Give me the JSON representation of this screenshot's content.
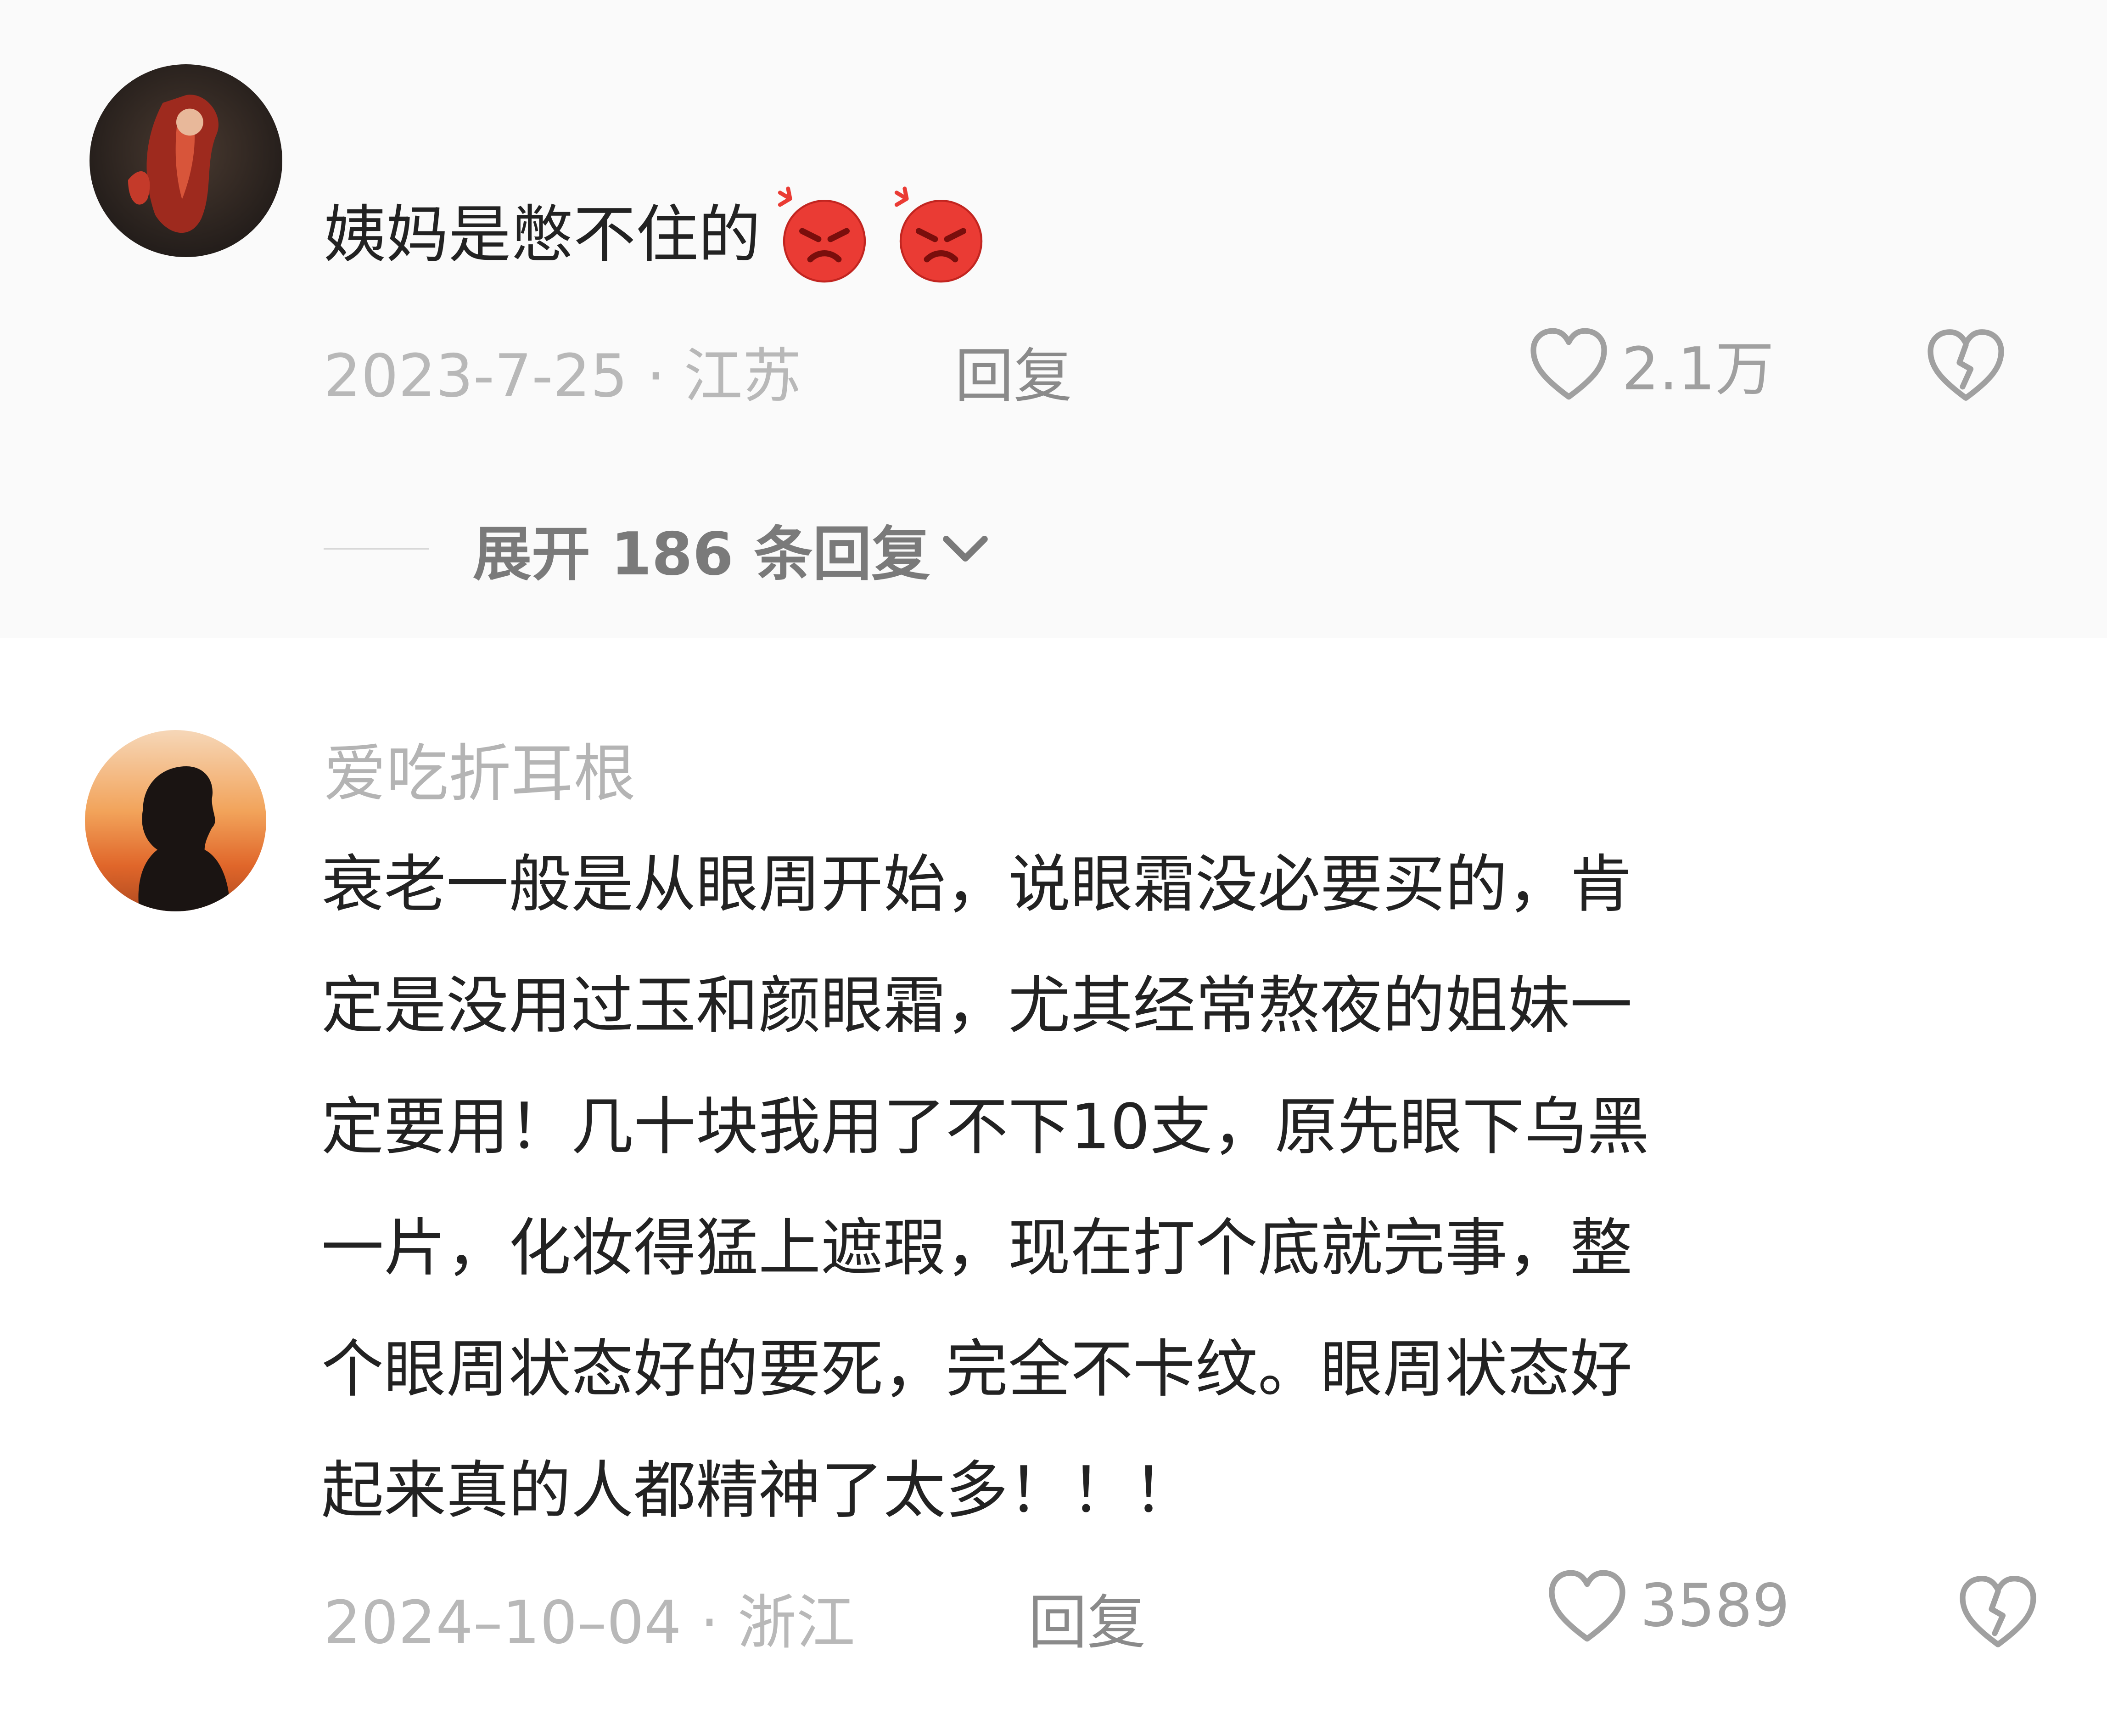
{
  "comments": [
    {
      "text": "姨妈是憋不住的",
      "emojis": [
        "angry-face-icon",
        "angry-face-icon"
      ],
      "date_location": "2023-7-25 · 江苏",
      "reply_label": "回复",
      "likes": "2.1万",
      "expand_label": "展开 186 条回复"
    },
    {
      "username": "爱吃折耳根",
      "text_lines": [
        "衰老一般是从眼周开始，说眼霜没必要买的，肯",
        "定是没用过玉和颜眼霜，尤其经常熬夜的姐妹一",
        "定要用！几十块我用了不下10支，原先眼下乌黑",
        "一片，化妆得猛上遮瑕，现在打个底就完事，整",
        "个眼周状态好的要死，完全不卡纹。眼周状态好",
        "起来真的人都精神了太多！！！"
      ],
      "date_location": "2024–10–04 · 浙江",
      "reply_label": "回复",
      "likes": "3589"
    }
  ],
  "colors": {
    "meta_text": "#b8b8b8",
    "body_text": "#222222",
    "angry_emoji": "#e8322f"
  }
}
